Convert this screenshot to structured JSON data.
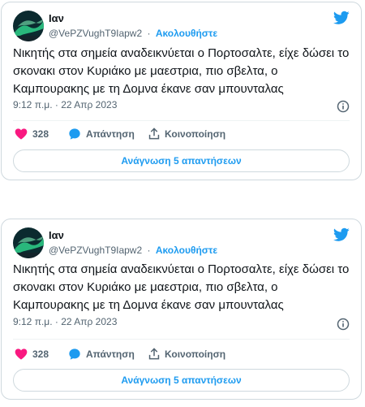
{
  "tweets": [
    {
      "author_name": "Ιαν",
      "handle": "@VePZVughT9Iapw2",
      "separator": "·",
      "follow_label": "Ακολουθήστε",
      "text": "Νικητής στα σημεία αναδεικνύεται ο Πορτοσαλτε, είχε δώσει το σκονακι στον Κυριάκο με μαεστρια, πιο σβελτα, ο Καμπουρακης με τη Δομνα έκανε σαν μπουνταλας",
      "timestamp": "9:12 π.μ. · 22 Απρ 2023",
      "like_count": "328",
      "reply_label": "Απάντηση",
      "share_label": "Κοινοποίηση",
      "read_replies_label": "Ανάγνωση 5 απαντήσεων",
      "icons": [
        "avatar",
        "twitter-bird-icon",
        "info-icon",
        "heart-icon",
        "reply-bubble-icon",
        "share-icon"
      ]
    },
    {
      "author_name": "Ιαν",
      "handle": "@VePZVughT9Iapw2",
      "separator": "·",
      "follow_label": "Ακολουθήστε",
      "text": "Νικητής στα σημεία αναδεικνύεται ο Πορτοσαλτε, είχε δώσει το σκονακι στον Κυριάκο με μαεστρια, πιο σβελτα, ο Καμπουρακης με τη Δομνα έκανε σαν μπουνταλας",
      "timestamp": "9:12 π.μ. · 22 Απρ 2023",
      "like_count": "328",
      "reply_label": "Απάντηση",
      "share_label": "Κοινοποίηση",
      "read_replies_label": "Ανάγνωση 5 απαντήσεων",
      "icons": [
        "avatar",
        "twitter-bird-icon",
        "info-icon",
        "heart-icon",
        "reply-bubble-icon",
        "share-icon"
      ]
    }
  ],
  "colors": {
    "accent": "#1d9bf0",
    "heart": "#f91880",
    "text": "#0f1419",
    "secondary": "#536471",
    "border": "#cfd9de"
  }
}
